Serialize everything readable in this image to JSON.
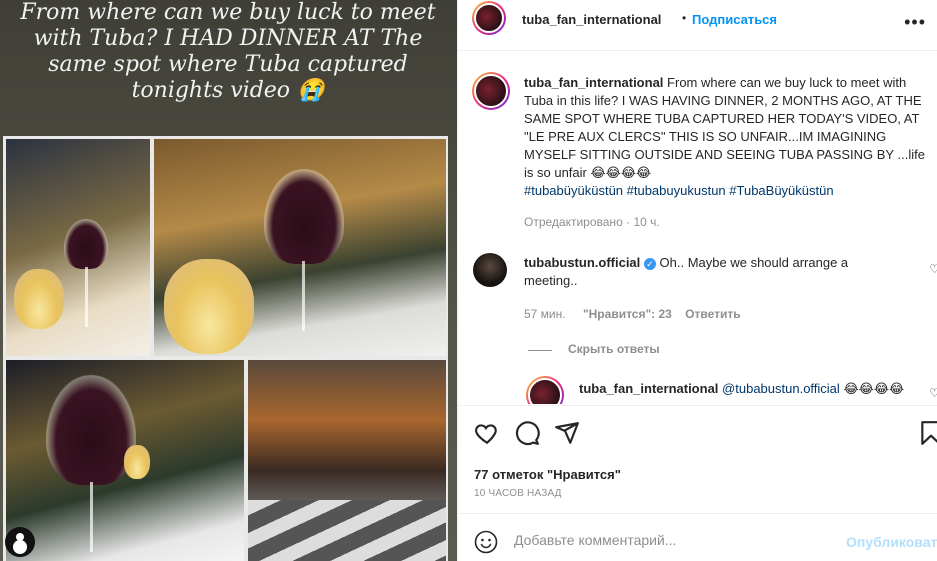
{
  "media": {
    "story_text": "From where can we buy luck to meet with Tuba? I HAD DINNER AT The same spot where Tuba captured tonights video 😭"
  },
  "header": {
    "username": "tuba_fan_international",
    "separator": "•",
    "follow_label": "Подписаться",
    "more_icon": "more-dots-icon"
  },
  "caption": {
    "username": "tuba_fan_international",
    "text": "From where can we buy luck to meet with Tuba in this life? I WAS HAVING DINNER, 2 MONTHS AGO, AT THE SAME SPOT WHERE TUBA CAPTURED HER TODAY'S VIDEO, AT \"LE PRE AUX CLERCS\" THIS IS SO UNFAIR...IM IMAGINING MYSELF SITTING OUTSIDE AND SEEING TUBA PASSING BY ...life is so unfair 😂😂😂😂",
    "hashtags": "#tubabüyüküstün #tubabuyukustun #TubaBüyüküstün",
    "edited_label": "Отредактировано",
    "separator": "·",
    "time": "10 ч."
  },
  "comment": {
    "username": "tubabustun.official",
    "text": "Oh.. Maybe we should arrange a meeting..",
    "time": "57 мин.",
    "likes_label": "\"Нравится\": 23",
    "reply_label": "Ответить",
    "hide_replies_label": "Скрыть ответы"
  },
  "reply": {
    "username": "tuba_fan_international",
    "mention": "@tubabustun.official",
    "text": "😂😂😂😂"
  },
  "actions": {
    "likes": "77 отметок \"Нравится\"",
    "posted_time": "10 ЧАСОВ НАЗАД"
  },
  "add_comment": {
    "placeholder": "Добавьте комментарий...",
    "post_label": "Опубликовать"
  },
  "colors": {
    "link_blue": "#0095f6",
    "hashtag": "#00376b",
    "muted": "#8e8e8e",
    "verified": "#3897f0"
  }
}
